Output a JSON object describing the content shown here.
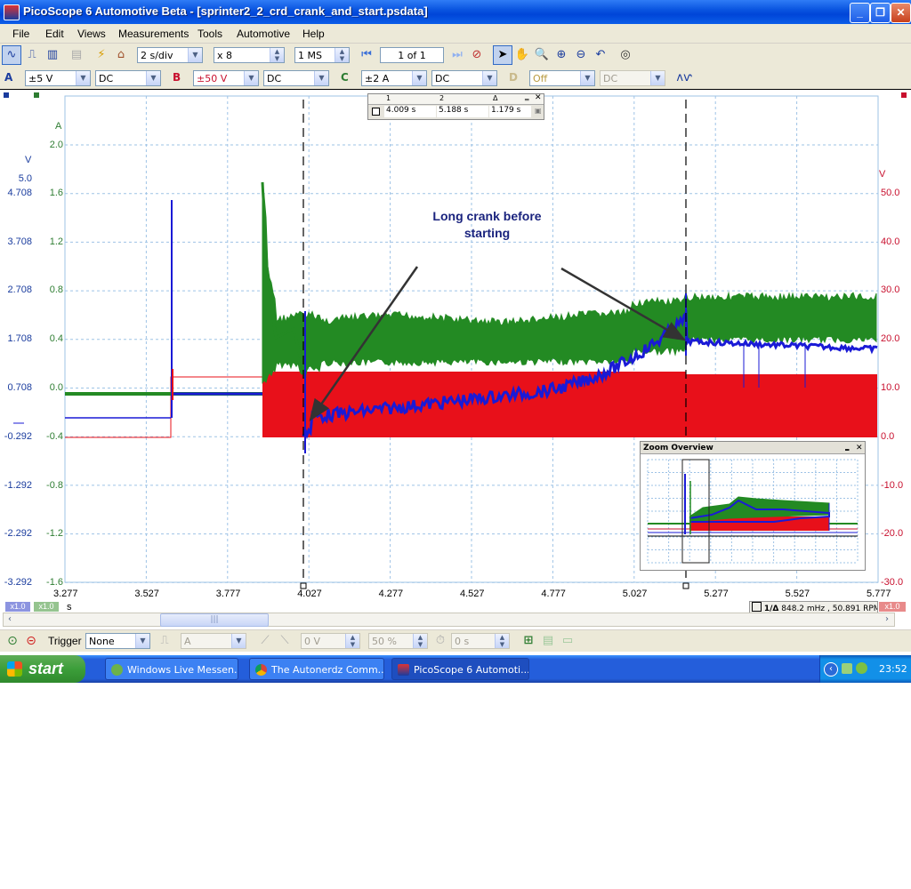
{
  "window": {
    "title": "PicoScope 6 Automotive Beta - [sprinter2_2_crd_crank_and_start.psdata]",
    "minimize_glyph": "_",
    "maximize_glyph": "❐",
    "close_glyph": "✕"
  },
  "menu": [
    "File",
    "Edit",
    "Views",
    "Measurements",
    "Tools",
    "Automotive",
    "Help"
  ],
  "toolbar": {
    "timebase": "2 s/div",
    "zoom": "x 8",
    "samples": "1 MS",
    "buffer": "1 of 1"
  },
  "channels": [
    {
      "letter": "A",
      "range": "±5 V",
      "coupling": "DC",
      "color": "#1a3c9e"
    },
    {
      "letter": "B",
      "range": "±50 V",
      "coupling": "DC",
      "color": "#c8102e"
    },
    {
      "letter": "C",
      "range": "±2 A",
      "coupling": "DC",
      "color": "#2e7d32"
    },
    {
      "letter": "D",
      "range": "Off",
      "coupling": "DC",
      "color": "#c9b98a"
    }
  ],
  "axes": {
    "a_unit": "A",
    "v_unit_left": "V",
    "v_unit_right": "V",
    "x_unit": "s",
    "blue_scale": [
      "5.0",
      "4.708",
      "3.708",
      "2.708",
      "1.708",
      "0.708",
      "-0.292",
      "-1.292",
      "-2.292",
      "-3.292"
    ],
    "green_scale": [
      "2.0",
      "1.6",
      "1.2",
      "0.8",
      "0.4",
      "0.0",
      "-0.4",
      "-0.8",
      "-1.2",
      "-1.6"
    ],
    "red_scale": [
      "50.0",
      "40.0",
      "30.0",
      "20.0",
      "10.0",
      "0.0",
      "-10.0",
      "-20.0",
      "-30.0"
    ],
    "x_ticks": [
      "3.277",
      "3.527",
      "3.777",
      "4.027",
      "4.277",
      "4.527",
      "4.777",
      "5.027",
      "5.277",
      "5.527",
      "5.777"
    ],
    "x1_left": "x1.0",
    "x1_left2": "x1.0",
    "x1_right": "x1.0"
  },
  "rulers": {
    "col1": "1",
    "col2": "2",
    "col3": "Δ",
    "t1": "4.009 s",
    "t2": "5.188 s",
    "dt": "1.179 s"
  },
  "annotation": {
    "line1": "Long crank before",
    "line2": "starting"
  },
  "zoom_overview_title": "Zoom Overview",
  "frequency_readout": "848.2 mHz , 50.891 RPM",
  "frequency_tag": "1/Δ",
  "trigger": {
    "label": "Trigger",
    "mode": "None",
    "source": "A",
    "threshold": "0 V",
    "position": "50 %",
    "delay": "0 s"
  },
  "taskbar": {
    "start": "start",
    "tasks": [
      "Windows Live Messen...",
      "The Autonerdz Comm...",
      "PicoScope 6 Automoti..."
    ],
    "clock": "23:52"
  },
  "colors": {
    "blue": "#1a1ad6",
    "red": "#e8101a",
    "green": "#238a23"
  }
}
